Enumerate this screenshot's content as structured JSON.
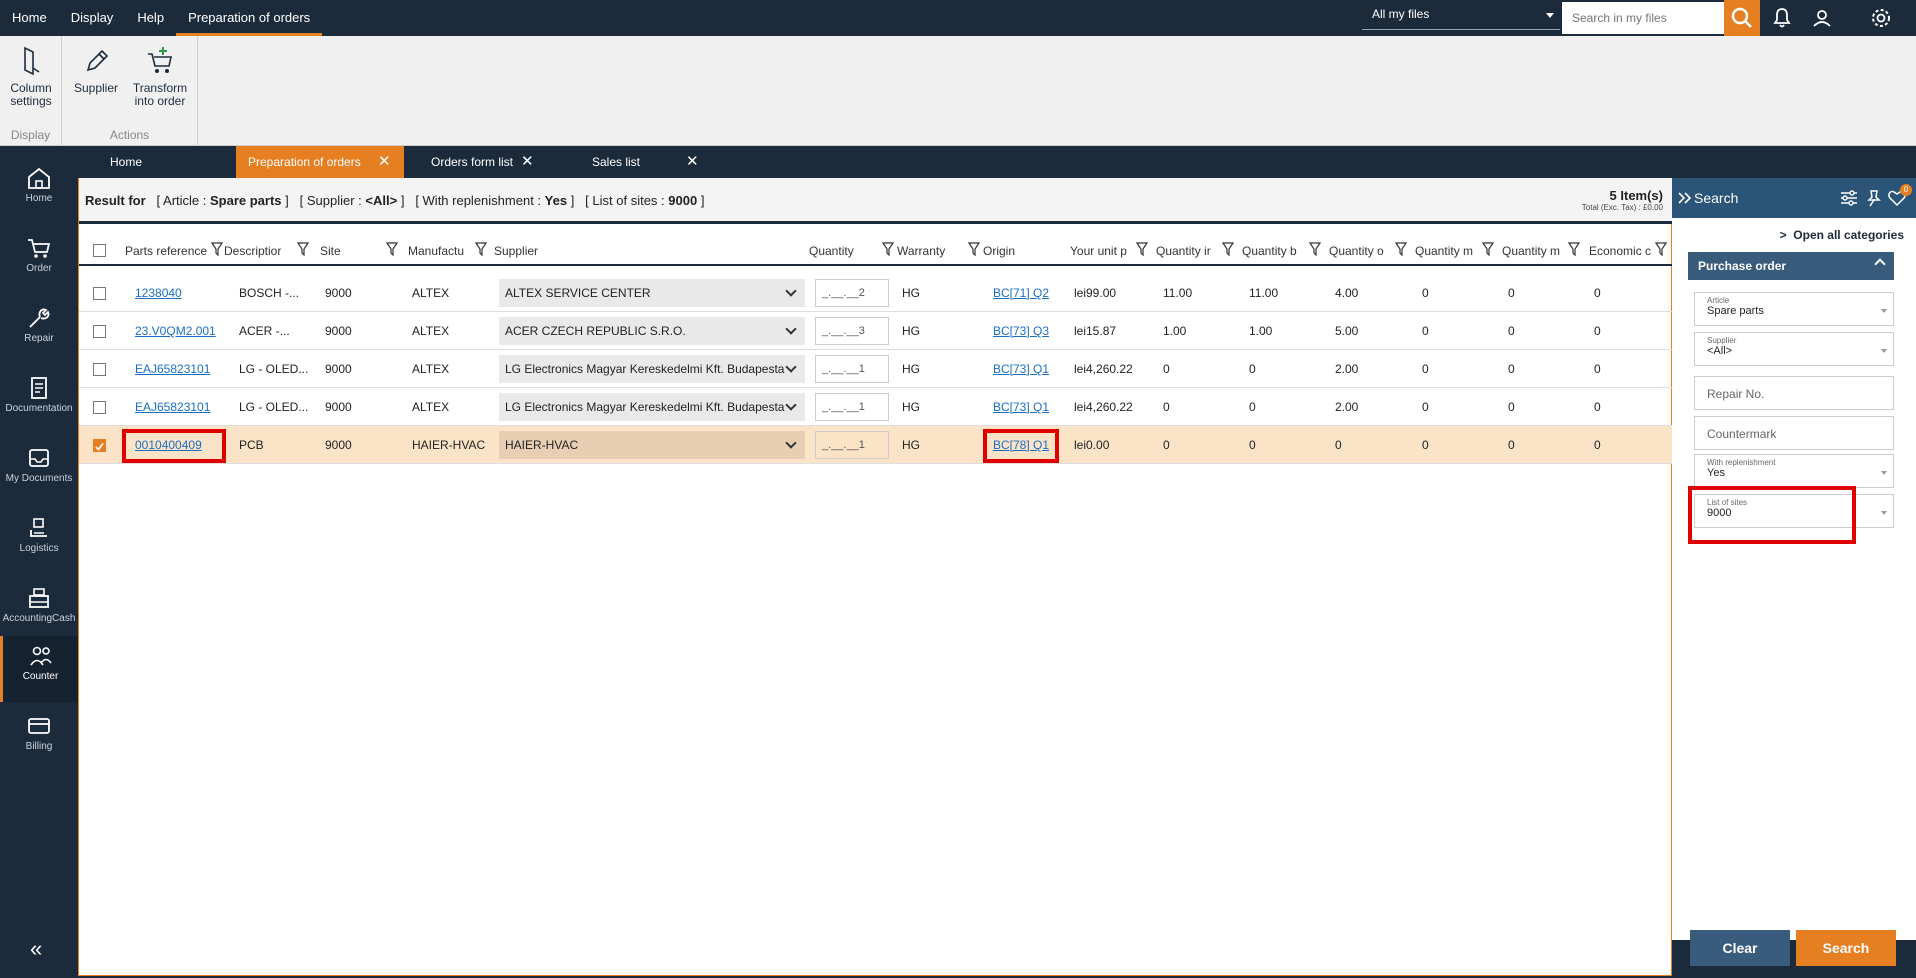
{
  "topmenu": {
    "items": [
      "Home",
      "Display",
      "Help",
      "Preparation of orders"
    ]
  },
  "files_select": "All my files",
  "search_placeholder": "Search in my files",
  "ribbon": {
    "display_group": "Display",
    "actions_group": "Actions",
    "column_settings_1": "Column",
    "column_settings_2": "settings",
    "supplier": "Supplier",
    "transform_1": "Transform",
    "transform_2": "into order"
  },
  "sidenav": [
    "Home",
    "Order",
    "Repair",
    "Documentation",
    "My Documents",
    "Logistics",
    "AccountingCash",
    "Counter",
    "Billing"
  ],
  "tabs": [
    "Home",
    "Preparation of orders",
    "Orders form list",
    "Sales list"
  ],
  "result": {
    "prefix": "Result for",
    "crit1_label": "[ Article :",
    "crit1_value": "Spare parts",
    "crit1_end": "]",
    "crit2_label": "[ Supplier :",
    "crit2_value": "<All>",
    "crit2_end": "]",
    "crit3_label": "[ With replenishment :",
    "crit3_value": "Yes",
    "crit3_end": "]",
    "crit4_label": "[ List of sites :",
    "crit4_value": "9000",
    "crit4_end": "]",
    "count": "5 Item(s)",
    "total": "Total (Exc. Tax) : £0.00"
  },
  "columns": [
    "Parts reference",
    "Descriptior",
    "Site",
    "Manufactu",
    "Supplier",
    "Quantity",
    "Warranty",
    "Origin",
    "Your unit p",
    "Quantity ir",
    "Quantity b",
    "Quantity o",
    "Quantity m",
    "Quantity m",
    "Economic c"
  ],
  "rows": [
    {
      "ref": "1238040",
      "desc": "BOSCH -...",
      "site": "9000",
      "manuf": "ALTEX",
      "supplier": "ALTEX SERVICE CENTER",
      "qty": "_.__.__2",
      "warranty": "HG",
      "origin": "BC[71] Q2",
      "price": "lei99.00",
      "q1": "11.00",
      "q2": "11.00",
      "q3": "4.00",
      "q4": "0",
      "q5": "0",
      "q6": "0",
      "checked": false
    },
    {
      "ref": "23.V0QM2.001",
      "desc": "ACER -...",
      "site": "9000",
      "manuf": "ALTEX",
      "supplier": "ACER CZECH REPUBLIC S.R.O.",
      "qty": "_.__.__3",
      "warranty": "HG",
      "origin": "BC[73] Q3",
      "price": "lei15.87",
      "q1": "1.00",
      "q2": "1.00",
      "q3": "5.00",
      "q4": "0",
      "q5": "0",
      "q6": "0",
      "checked": false
    },
    {
      "ref": "EAJ65823101",
      "desc": "LG - OLED...",
      "site": "9000",
      "manuf": "ALTEX",
      "supplier": "LG Electronics Magyar Kereskedelmi Kft. Budapesta",
      "qty": "_.__.__1",
      "warranty": "HG",
      "origin": "BC[73] Q1",
      "price": "lei4,260.22",
      "q1": "0",
      "q2": "0",
      "q3": "2.00",
      "q4": "0",
      "q5": "0",
      "q6": "0",
      "checked": false
    },
    {
      "ref": "EAJ65823101",
      "desc": "LG - OLED...",
      "site": "9000",
      "manuf": "ALTEX",
      "supplier": "LG Electronics Magyar Kereskedelmi Kft. Budapesta",
      "qty": "_.__.__1",
      "warranty": "HG",
      "origin": "BC[73] Q1",
      "price": "lei4,260.22",
      "q1": "0",
      "q2": "0",
      "q3": "2.00",
      "q4": "0",
      "q5": "0",
      "q6": "0",
      "checked": false
    },
    {
      "ref": "0010400409",
      "desc": "PCB",
      "site": "9000",
      "manuf": "HAIER-HVAC",
      "supplier": "HAIER-HVAC",
      "qty": "_.__.__1",
      "warranty": "HG",
      "origin": "BC[78] Q1",
      "price": "lei0.00",
      "q1": "0",
      "q2": "0",
      "q3": "0",
      "q4": "0",
      "q5": "0",
      "q6": "0",
      "checked": true
    }
  ],
  "panel": {
    "title": "Search",
    "badge": "0",
    "open_all": "Open all categories",
    "section": "Purchase order",
    "article_label": "Article",
    "article_value": "Spare parts",
    "supplier_label": "Supplier",
    "supplier_value": "<All>",
    "repair_placeholder": "Repair No.",
    "countermark_placeholder": "Countermark",
    "repl_label": "With replenishment",
    "repl_value": "Yes",
    "sites_label": "List of sites",
    "sites_value": "9000",
    "clear": "Clear",
    "search": "Search"
  },
  "colors": {
    "navy": "#1c2b3c",
    "accent": "#e67e22",
    "link": "#1a6fc4",
    "selected_row": "#fbe3c8",
    "highlight": "#e00000"
  }
}
